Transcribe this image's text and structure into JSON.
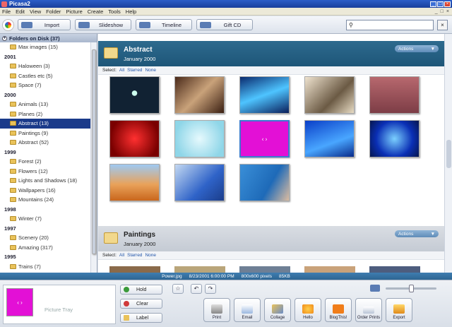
{
  "window": {
    "title": "Picasa2"
  },
  "menu": [
    "File",
    "Edit",
    "View",
    "Folder",
    "Picture",
    "Create",
    "Tools",
    "Help"
  ],
  "toolbar": {
    "import": "Import",
    "slideshow": "Slideshow",
    "timeline": "Timeline",
    "giftcd": "Gift CD",
    "search_value": ""
  },
  "folders_header": "Folders on Disk (37)",
  "folder_tree": [
    {
      "type": "folder",
      "label": "Max images (15)"
    },
    {
      "type": "year",
      "label": "2001"
    },
    {
      "type": "folder",
      "label": "Haloween (3)"
    },
    {
      "type": "folder",
      "label": "Castles etc (5)"
    },
    {
      "type": "folder",
      "label": "Space (7)"
    },
    {
      "type": "year",
      "label": "2000"
    },
    {
      "type": "folder",
      "label": "Animals (13)"
    },
    {
      "type": "folder",
      "label": "Planes (2)"
    },
    {
      "type": "folder",
      "label": "Abstract (13)",
      "selected": true
    },
    {
      "type": "folder",
      "label": "Paintings (9)"
    },
    {
      "type": "folder",
      "label": "Abstract (52)"
    },
    {
      "type": "year",
      "label": "1999"
    },
    {
      "type": "folder",
      "label": "Forest (2)"
    },
    {
      "type": "folder",
      "label": "Flowers (12)"
    },
    {
      "type": "folder",
      "label": "Lights and Shadows (18)"
    },
    {
      "type": "folder",
      "label": "Wallpapers (16)"
    },
    {
      "type": "folder",
      "label": "Mountains (24)"
    },
    {
      "type": "year",
      "label": "1998"
    },
    {
      "type": "folder",
      "label": "Winter (7)"
    },
    {
      "type": "year",
      "label": "1997"
    },
    {
      "type": "folder",
      "label": "Scenery (20)"
    },
    {
      "type": "folder",
      "label": "Amazing (317)"
    },
    {
      "type": "year",
      "label": "1995"
    },
    {
      "type": "folder",
      "label": "Trains (7)"
    }
  ],
  "sections": {
    "abstract": {
      "title": "Abstract",
      "date": "January 2000",
      "actions": "Actions"
    },
    "paintings": {
      "title": "Paintings",
      "date": "January 2000",
      "actions": "Actions"
    }
  },
  "selectbar": {
    "label": "Select:",
    "all": "All",
    "starred": "Starred",
    "none": "None"
  },
  "thumbnails": [
    {
      "name": "thumb-dots",
      "bg": "radial-gradient(circle at 50% 45%, #cfe 0 8%, #123 9% 100%)"
    },
    {
      "name": "thumb-room",
      "bg": "linear-gradient(135deg, #4a2a1a, #c9a27a 50%, #3a1f12)"
    },
    {
      "name": "thumb-aurora",
      "bg": "linear-gradient(160deg, #0a2a6e, #4ec4ff 50%, #0a1e5a)"
    },
    {
      "name": "thumb-sepia",
      "bg": "linear-gradient(135deg, #efe3cf, #6b5a44 60%, #e8dcc4)"
    },
    {
      "name": "thumb-window",
      "bg": "linear-gradient(#b7686e, #7d3d46)"
    },
    {
      "name": "thumb-red",
      "bg": "radial-gradient(circle, #ff3030, #7a0000 80%)"
    },
    {
      "name": "thumb-cyan",
      "bg": "radial-gradient(circle, #e6f9fd, #8fd6e8 80%)"
    },
    {
      "name": "thumb-magenta",
      "bg": "#e310d6",
      "selected": true
    },
    {
      "name": "thumb-bluewave",
      "bg": "linear-gradient(160deg, #0a3fc8, #49a6ff 60%, #082a8a)"
    },
    {
      "name": "thumb-tunnel",
      "bg": "radial-gradient(circle, #7bd0ff, #0a2fb5 60%, #06164e)"
    },
    {
      "name": "thumb-dunes",
      "bg": "linear-gradient(#9ec9f2, #e9a25a 55%, #c9661c)"
    },
    {
      "name": "thumb-windows",
      "bg": "linear-gradient(135deg, #c4d9f2, #2f63c8 60%, #1b3d8a)"
    },
    {
      "name": "thumb-tennis",
      "bg": "linear-gradient(120deg, #3a8fd8, #1e6ab8 60%, #dcbca0)"
    }
  ],
  "status": {
    "file": "Power.jpg",
    "date": "8/23/2001 6:00:00 PM",
    "dims": "800x600 pixels",
    "size": "85KB"
  },
  "tray": {
    "label": "Picture Tray",
    "hold": "Hold",
    "clear": "Clear",
    "label_btn": "Label",
    "actions": [
      "Print",
      "Email",
      "Collage",
      "Hello",
      "BlogThis!",
      "Order Prints",
      "Export"
    ]
  }
}
